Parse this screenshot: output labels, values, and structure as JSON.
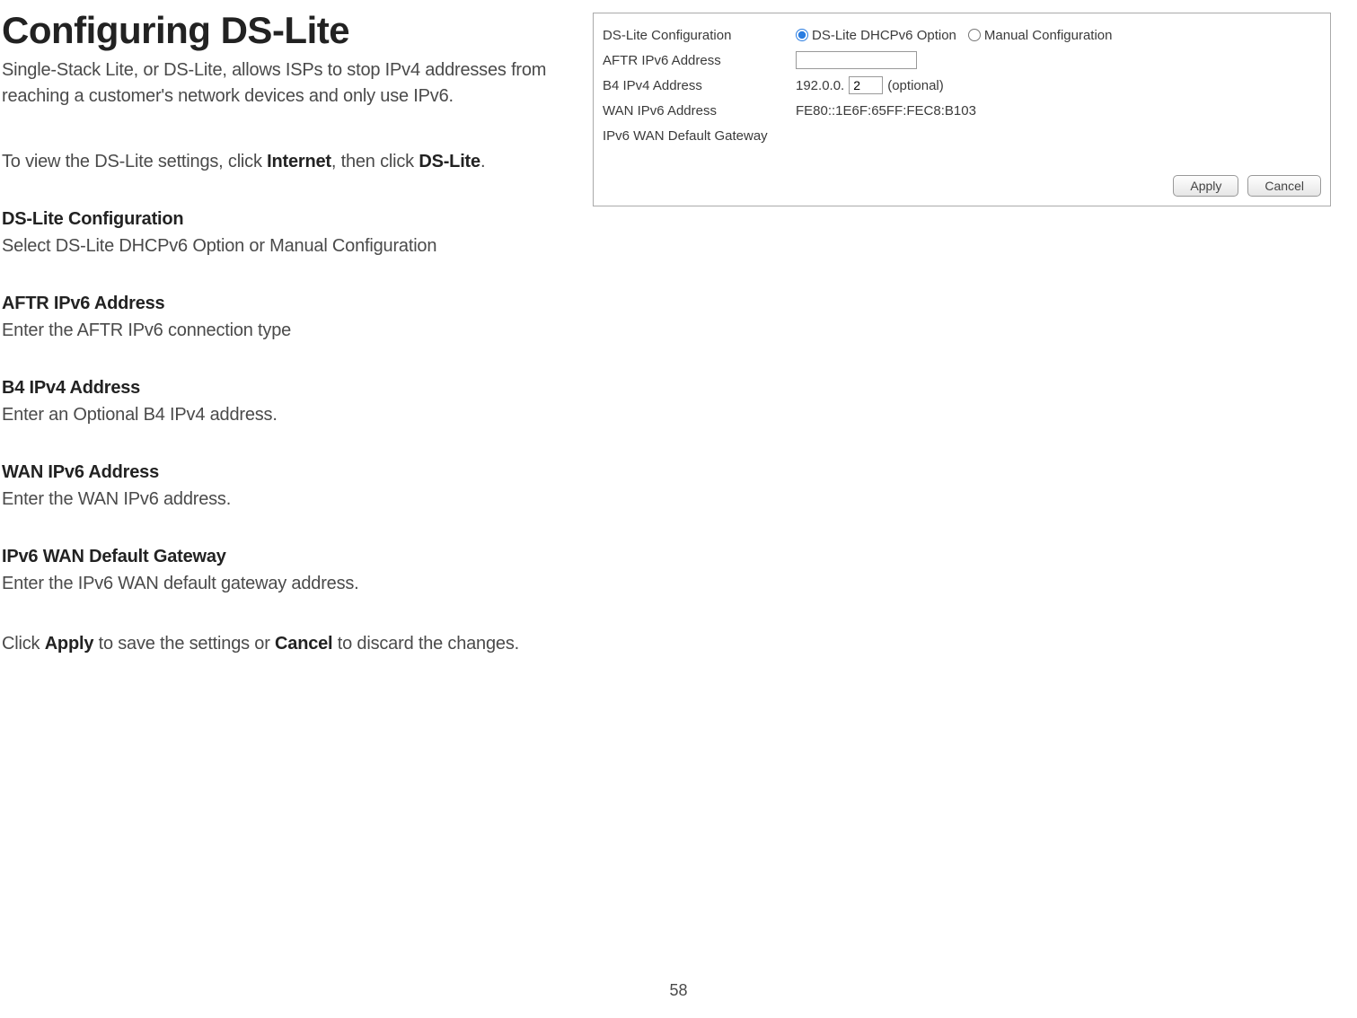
{
  "page": {
    "title": "Configuring DS-Lite",
    "intro": "Single-Stack Lite, or DS-Lite, allows ISPs to stop IPv4 addresses from reaching a customer's network devices and only use IPv6.",
    "nav_instruction_pre": "To view the DS-Lite settings, click ",
    "nav_instruction_bold1": "Internet",
    "nav_instruction_mid": ", then click ",
    "nav_instruction_bold2": "DS-Lite",
    "nav_instruction_end": ".",
    "footer_pre": "Click ",
    "footer_bold1": "Apply",
    "footer_mid": " to save the settings or ",
    "footer_bold2": "Cancel",
    "footer_end": " to discard the changes.",
    "page_number": "58"
  },
  "sections": {
    "dslite_config": {
      "heading": "DS-Lite Configuration",
      "body": "Select DS-Lite DHCPv6 Option or Manual Configuration"
    },
    "aftr": {
      "heading": "AFTR IPv6 Address",
      "body": "Enter the AFTR IPv6 connection type"
    },
    "b4": {
      "heading": "B4 IPv4 Address",
      "body": "Enter an Optional B4 IPv4 address."
    },
    "wan_ipv6": {
      "heading": "WAN IPv6 Address",
      "body": "Enter the WAN IPv6 address."
    },
    "ipv6_gw": {
      "heading": "IPv6 WAN Default Gateway",
      "body": "Enter the IPv6 WAN default gateway address."
    }
  },
  "panel": {
    "rows": {
      "config": {
        "label": "DS-Lite Configuration",
        "radio1": "DS-Lite DHCPv6 Option",
        "radio2": "Manual Configuration",
        "selected": "dhcpv6"
      },
      "aftr": {
        "label": "AFTR IPv6 Address",
        "value": ""
      },
      "b4": {
        "label": "B4 IPv4 Address",
        "prefix": "192.0.0.",
        "value": "2",
        "suffix": "(optional)"
      },
      "wan": {
        "label": "WAN IPv6 Address",
        "value": "FE80::1E6F:65FF:FEC8:B103"
      },
      "gw": {
        "label": "IPv6 WAN Default Gateway",
        "value": ""
      }
    },
    "buttons": {
      "apply": "Apply",
      "cancel": "Cancel"
    }
  }
}
